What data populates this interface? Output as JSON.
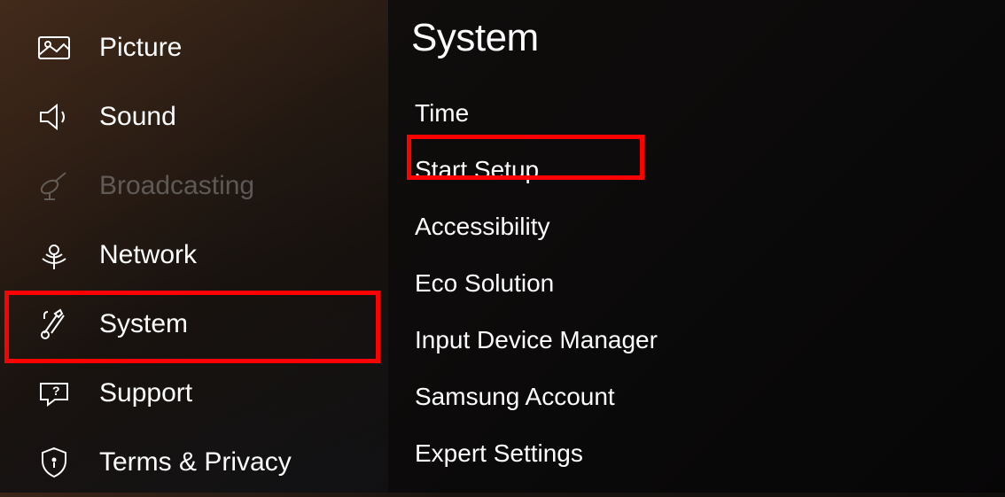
{
  "sidebar": {
    "items": [
      {
        "label": "Picture",
        "icon": "picture"
      },
      {
        "label": "Sound",
        "icon": "sound"
      },
      {
        "label": "Broadcasting",
        "icon": "broadcasting",
        "disabled": true
      },
      {
        "label": "Network",
        "icon": "network"
      },
      {
        "label": "System",
        "icon": "system"
      },
      {
        "label": "Support",
        "icon": "support"
      },
      {
        "label": "Terms & Privacy",
        "icon": "privacy"
      }
    ]
  },
  "content": {
    "title": "System",
    "items": [
      {
        "label": "Time"
      },
      {
        "label": "Start Setup"
      },
      {
        "label": "Accessibility"
      },
      {
        "label": "Eco Solution"
      },
      {
        "label": "Input Device Manager"
      },
      {
        "label": "Samsung Account"
      },
      {
        "label": "Expert Settings"
      }
    ]
  },
  "highlights": {
    "sidebar_index": 4,
    "content_index": 1
  }
}
